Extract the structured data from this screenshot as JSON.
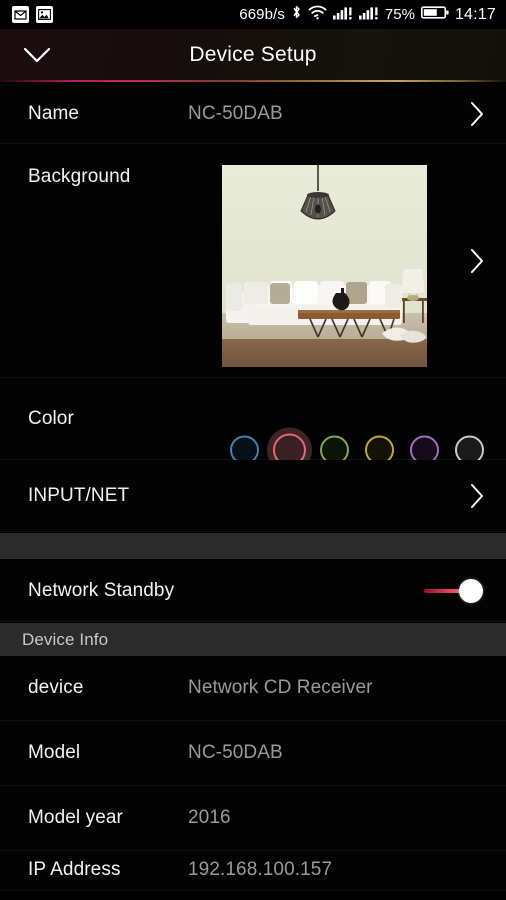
{
  "statusbar": {
    "icons_left": [
      "gmail-icon",
      "photo-icon"
    ],
    "network_speed": "669b/s",
    "bluetooth": "bluetooth-icon",
    "wifi": "wifi-icon",
    "signal1": "signal-bars-icon",
    "signal2": "signal-bars-icon",
    "battery_percent": "75%",
    "battery": "battery-icon",
    "time": "14:17"
  },
  "header": {
    "title": "Device Setup",
    "back_icon": "chevron-down-icon",
    "accent_from": "#c02a5e",
    "accent_to": "#c9a55c"
  },
  "settings": {
    "name": {
      "label": "Name",
      "value": "NC-50DAB",
      "chevron": "chevron-right-icon"
    },
    "background": {
      "label": "Background",
      "chevron": "chevron-right-icon",
      "image_alt": "living-room-white-sofa"
    },
    "color": {
      "label": "Color",
      "selected_index": 1,
      "swatches": [
        {
          "name": "blue",
          "ring": "#4a7ea8",
          "fill": "#061018"
        },
        {
          "name": "pink",
          "ring": "#e8647e",
          "fill": "#2a1417"
        },
        {
          "name": "green",
          "ring": "#7aa85a",
          "fill": "#0c1408"
        },
        {
          "name": "amber",
          "ring": "#c2a646",
          "fill": "#151207"
        },
        {
          "name": "purple",
          "ring": "#a26cc4",
          "fill": "#140b19"
        },
        {
          "name": "white",
          "ring": "#c9c9c9",
          "fill": "#1a1a1a"
        }
      ]
    },
    "input_net": {
      "label": "INPUT/NET",
      "chevron": "chevron-right-icon"
    },
    "network_standby": {
      "label": "Network Standby",
      "state": "on",
      "accent": "#e0405c"
    }
  },
  "device_info": {
    "section_title": "Device Info",
    "rows": [
      {
        "label": "device",
        "value": "Network CD Receiver"
      },
      {
        "label": "Model",
        "value": "NC-50DAB"
      },
      {
        "label": "Model year",
        "value": "2016"
      },
      {
        "label": "IP Address",
        "value": "192.168.100.157"
      }
    ]
  }
}
